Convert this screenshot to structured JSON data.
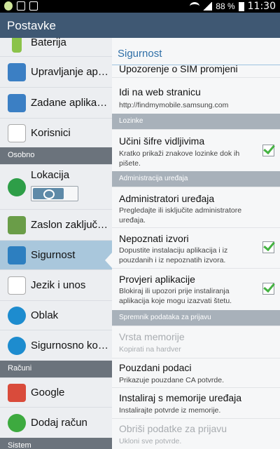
{
  "status_bar": {
    "battery": "88 %",
    "time": "11:30"
  },
  "app_title": "Postavke",
  "left_menu": {
    "items": [
      {
        "label": "Baterija"
      },
      {
        "label": "Upravljanje aplikacijama"
      },
      {
        "label": "Zadane aplikacije"
      },
      {
        "label": "Korisnici"
      },
      {
        "label": "Lokacija"
      },
      {
        "label": "Zaslon zaključavanja"
      },
      {
        "label": "Sigurnost"
      },
      {
        "label": "Jezik i unos"
      },
      {
        "label": "Oblak"
      },
      {
        "label": "Sigurnosno kopiranje"
      },
      {
        "label": "Google"
      },
      {
        "label": "Dodaj račun"
      }
    ],
    "headers": {
      "osobno": "Osobno",
      "racuni": "Računi",
      "sistem": "Sistem"
    },
    "location_toggle": true
  },
  "detail": {
    "title": "Sigurnost",
    "sim_warning": "Upozorenje o SIM promjeni",
    "web": {
      "title": "Idi na web stranicu",
      "subtitle": "http://findmymobile.samsung.com"
    },
    "header_passwords": "Lozinke",
    "show_passwords": {
      "title": "Učini šifre vidljivima",
      "subtitle": "Kratko prikaži znakove lozinke dok ih pišete.",
      "checked": true
    },
    "header_admin": "Administracija uređaja",
    "admins": {
      "title": "Administratori uređaja",
      "subtitle": "Pregledajte ili isključite administratore uređaja."
    },
    "unknown_sources": {
      "title": "Nepoznati izvori",
      "subtitle": "Dopustite instalaciju aplikacija i iz pouzdanih i iz nepoznatih izvora.",
      "checked": true
    },
    "verify_apps": {
      "title": "Provjeri aplikacije",
      "subtitle": "Blokiraj ili upozori prije instaliranja aplikacija koje mogu izazvati štetu.",
      "checked": true
    },
    "header_storage": "Spremnik podataka za prijavu",
    "storage_type": {
      "title": "Vrsta memorije",
      "subtitle": "Kopirati na hardver"
    },
    "trusted": {
      "title": "Pouzdani podaci",
      "subtitle": "Prikazuje pouzdane CA potvrde."
    },
    "install": {
      "title": "Instaliraj s memorije uređaja",
      "subtitle": "Instalirajte potvrde iz memorije."
    },
    "clear": {
      "title": "Obriši podatke za prijavu",
      "subtitle": "Ukloni sve potvrde."
    }
  },
  "colors": {
    "action_bar": "#3f5873",
    "accent": "#2f6fa7",
    "selected": "#a9c7dc",
    "check": "#45b342"
  }
}
